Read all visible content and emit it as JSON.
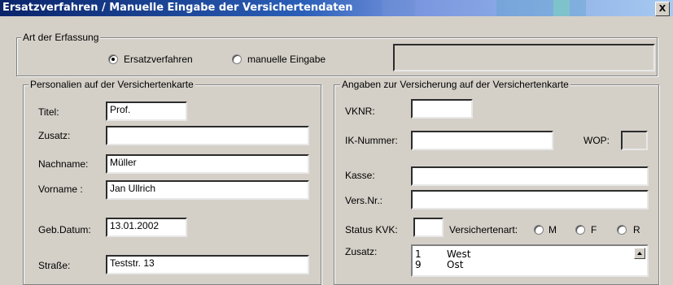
{
  "window": {
    "title": "Ersatzverfahren / Manuelle Eingabe der Versichertendaten",
    "close_glyph": "X"
  },
  "erfassung": {
    "legend": "Art der Erfassung",
    "option_ersatz": "Ersatzverfahren",
    "option_manuell": "manuelle Eingabe",
    "selected": "Ersatzverfahren"
  },
  "personalien": {
    "legend": "Personalien auf der Versichertenkarte",
    "titel_label": "Titel:",
    "titel_value": "Prof.",
    "zusatz_label": "Zusatz:",
    "zusatz_value": "",
    "nachname_label": "Nachname:",
    "nachname_value": "Müller",
    "vorname_label": "Vorname :",
    "vorname_value": "Jan Ullrich",
    "gebdatum_label": "Geb.Datum:",
    "gebdatum_value": "13.01.2002",
    "strasse_label": "Straße:",
    "strasse_value": "Teststr. 13"
  },
  "versicherung": {
    "legend": "Angaben zur Versicherung auf der Versichertenkarte",
    "vknr_label": "VKNR:",
    "vknr_value": "",
    "ik_label": "IK-Nummer:",
    "ik_value": "",
    "wop_label": "WOP:",
    "wop_value": "",
    "kasse_label": "Kasse:",
    "kasse_value": "",
    "versnr_label": "Vers.Nr.:",
    "versnr_value": "",
    "status_label": "Status KVK:",
    "status_value": "",
    "versichertenart_label": "Versichertenart:",
    "art_m": "M",
    "art_f": "F",
    "art_r": "R",
    "zusatz_label": "Zusatz:",
    "zusatz_list": [
      {
        "num": "1",
        "name": "West"
      },
      {
        "num": "9",
        "name": "Ost"
      }
    ]
  }
}
